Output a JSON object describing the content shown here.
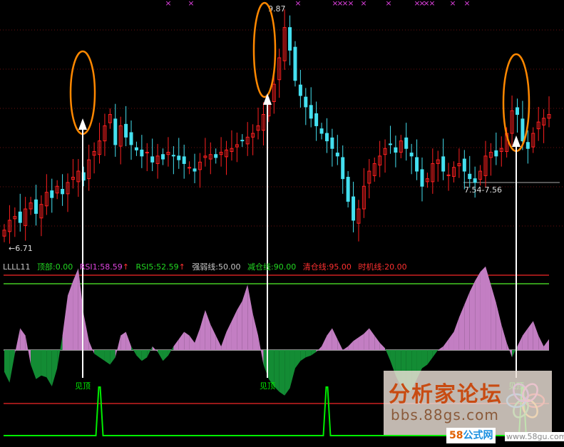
{
  "indicator_name": "LLLL11",
  "legend": [
    {
      "label": "顶部:0.00",
      "color": "#22d822"
    },
    {
      "label": "RSI1:58.59",
      "color": "#e046e0"
    },
    {
      "label": "RSI5:52.59",
      "color": "#22d822"
    },
    {
      "label": "强弱线:50.00",
      "color": "#c8c8c8"
    },
    {
      "label": "减仓线:90.00",
      "color": "#22d822"
    },
    {
      "label": "清仓线:95.00",
      "color": "#ff3030"
    },
    {
      "label": "时机线:20.00",
      "color": "#ff3030"
    }
  ],
  "price_labels": {
    "high": "9.87",
    "low": "←6.71",
    "range": "7.54-7.56"
  },
  "signal_text": "见顶",
  "watermark": {
    "brand": "分析家论坛",
    "url": "bbs.88gs.com",
    "badge_58": "58",
    "badge_gs": "公式网",
    "site": "www.58gu.com"
  },
  "colors": {
    "up": "#ff2020",
    "down": "#44e0f0",
    "pos": "#c37ec3",
    "neg": "#138c34",
    "signal": "#00ee00",
    "circle": "#ff8800",
    "arrow": "#ffffff",
    "marker": "#e040e0"
  },
  "chart_data": [
    {
      "type": "candlestick",
      "y_range": [
        6.71,
        9.87
      ],
      "annotations": [
        "9.87",
        "←6.71",
        "7.54-7.56"
      ],
      "close_series": [
        6.92,
        7.05,
        7.1,
        7.02,
        7.2,
        7.28,
        7.14,
        7.26,
        7.42,
        7.35,
        7.5,
        7.4,
        7.55,
        7.62,
        7.7,
        7.58,
        7.85,
        7.96,
        8.1,
        8.3,
        8.45,
        8.05,
        8.3,
        8.15,
        8.05,
        7.98,
        7.9,
        7.95,
        7.82,
        7.9,
        7.86,
        7.95,
        7.9,
        7.85,
        7.8,
        7.75,
        7.7,
        7.82,
        7.9,
        7.92,
        7.88,
        7.95,
        7.98,
        8.0,
        8.05,
        8.1,
        8.15,
        8.2,
        8.3,
        8.45,
        8.6,
        8.85,
        9.2,
        9.6,
        9.3,
        8.9,
        8.7,
        8.55,
        8.4,
        8.3,
        8.2,
        8.1,
        8.0,
        7.9,
        7.6,
        7.3,
        7.05,
        7.2,
        7.5,
        7.7,
        7.8,
        7.9,
        8.0,
        8.05,
        7.95,
        8.1,
        8.0,
        7.9,
        7.7,
        7.5,
        7.6,
        7.8,
        7.85,
        7.7,
        7.65,
        7.75,
        7.8,
        7.7,
        7.6,
        7.55,
        7.7,
        7.9,
        7.95,
        7.9,
        8.0,
        8.2,
        8.5,
        8.45,
        8.1,
        8.0,
        8.2,
        8.35,
        8.4,
        8.45
      ]
    },
    {
      "type": "area",
      "name": "LLLL11",
      "y_range": [
        0,
        100
      ],
      "levels": {
        "强弱线": 50,
        "减仓线": 90,
        "清仓线": 95,
        "时机线": 20
      },
      "values": [
        38,
        32,
        48,
        62,
        58,
        42,
        34,
        36,
        35,
        30,
        40,
        58,
        80,
        88,
        95,
        70,
        55,
        48,
        46,
        44,
        42,
        46,
        58,
        60,
        52,
        47,
        44,
        46,
        52,
        49,
        44,
        47,
        52,
        56,
        60,
        58,
        54,
        62,
        72,
        64,
        58,
        52,
        60,
        66,
        72,
        77,
        86,
        70,
        58,
        42,
        34,
        30,
        27,
        25,
        29,
        40,
        44,
        46,
        47,
        49,
        52,
        58,
        62,
        56,
        50,
        52,
        55,
        57,
        59,
        62,
        58,
        54,
        51,
        44,
        36,
        30,
        26,
        28,
        34,
        40,
        42,
        46,
        50,
        52,
        56,
        60,
        68,
        75,
        82,
        88,
        93,
        96,
        86,
        76,
        64,
        54,
        46,
        52,
        58,
        62,
        66,
        58,
        52,
        56
      ]
    },
    {
      "type": "line",
      "name": "顶部",
      "values": [
        0,
        0,
        0,
        0,
        0,
        0,
        0,
        0,
        0,
        0,
        0,
        0,
        0,
        0,
        0,
        0,
        0,
        0,
        0,
        0,
        0,
        0,
        0,
        0,
        0,
        0,
        0,
        0,
        0,
        0,
        0,
        0,
        0,
        0,
        0,
        0,
        0,
        0,
        0,
        0,
        0,
        0,
        0,
        0,
        0,
        0,
        0,
        0,
        0,
        0,
        0,
        0,
        0,
        0,
        0,
        0,
        0,
        0,
        0,
        0,
        0,
        0,
        0,
        0,
        0,
        0,
        0,
        0,
        0,
        0,
        0,
        0,
        0,
        0,
        0,
        0,
        0,
        0,
        0,
        0,
        0,
        0,
        0,
        0,
        0,
        0,
        0,
        0,
        0,
        0,
        0,
        0,
        0,
        0,
        0,
        0,
        0,
        0,
        0,
        0,
        0,
        0,
        0,
        0
      ],
      "spikes_at_bar": [
        18,
        61,
        98
      ]
    }
  ]
}
